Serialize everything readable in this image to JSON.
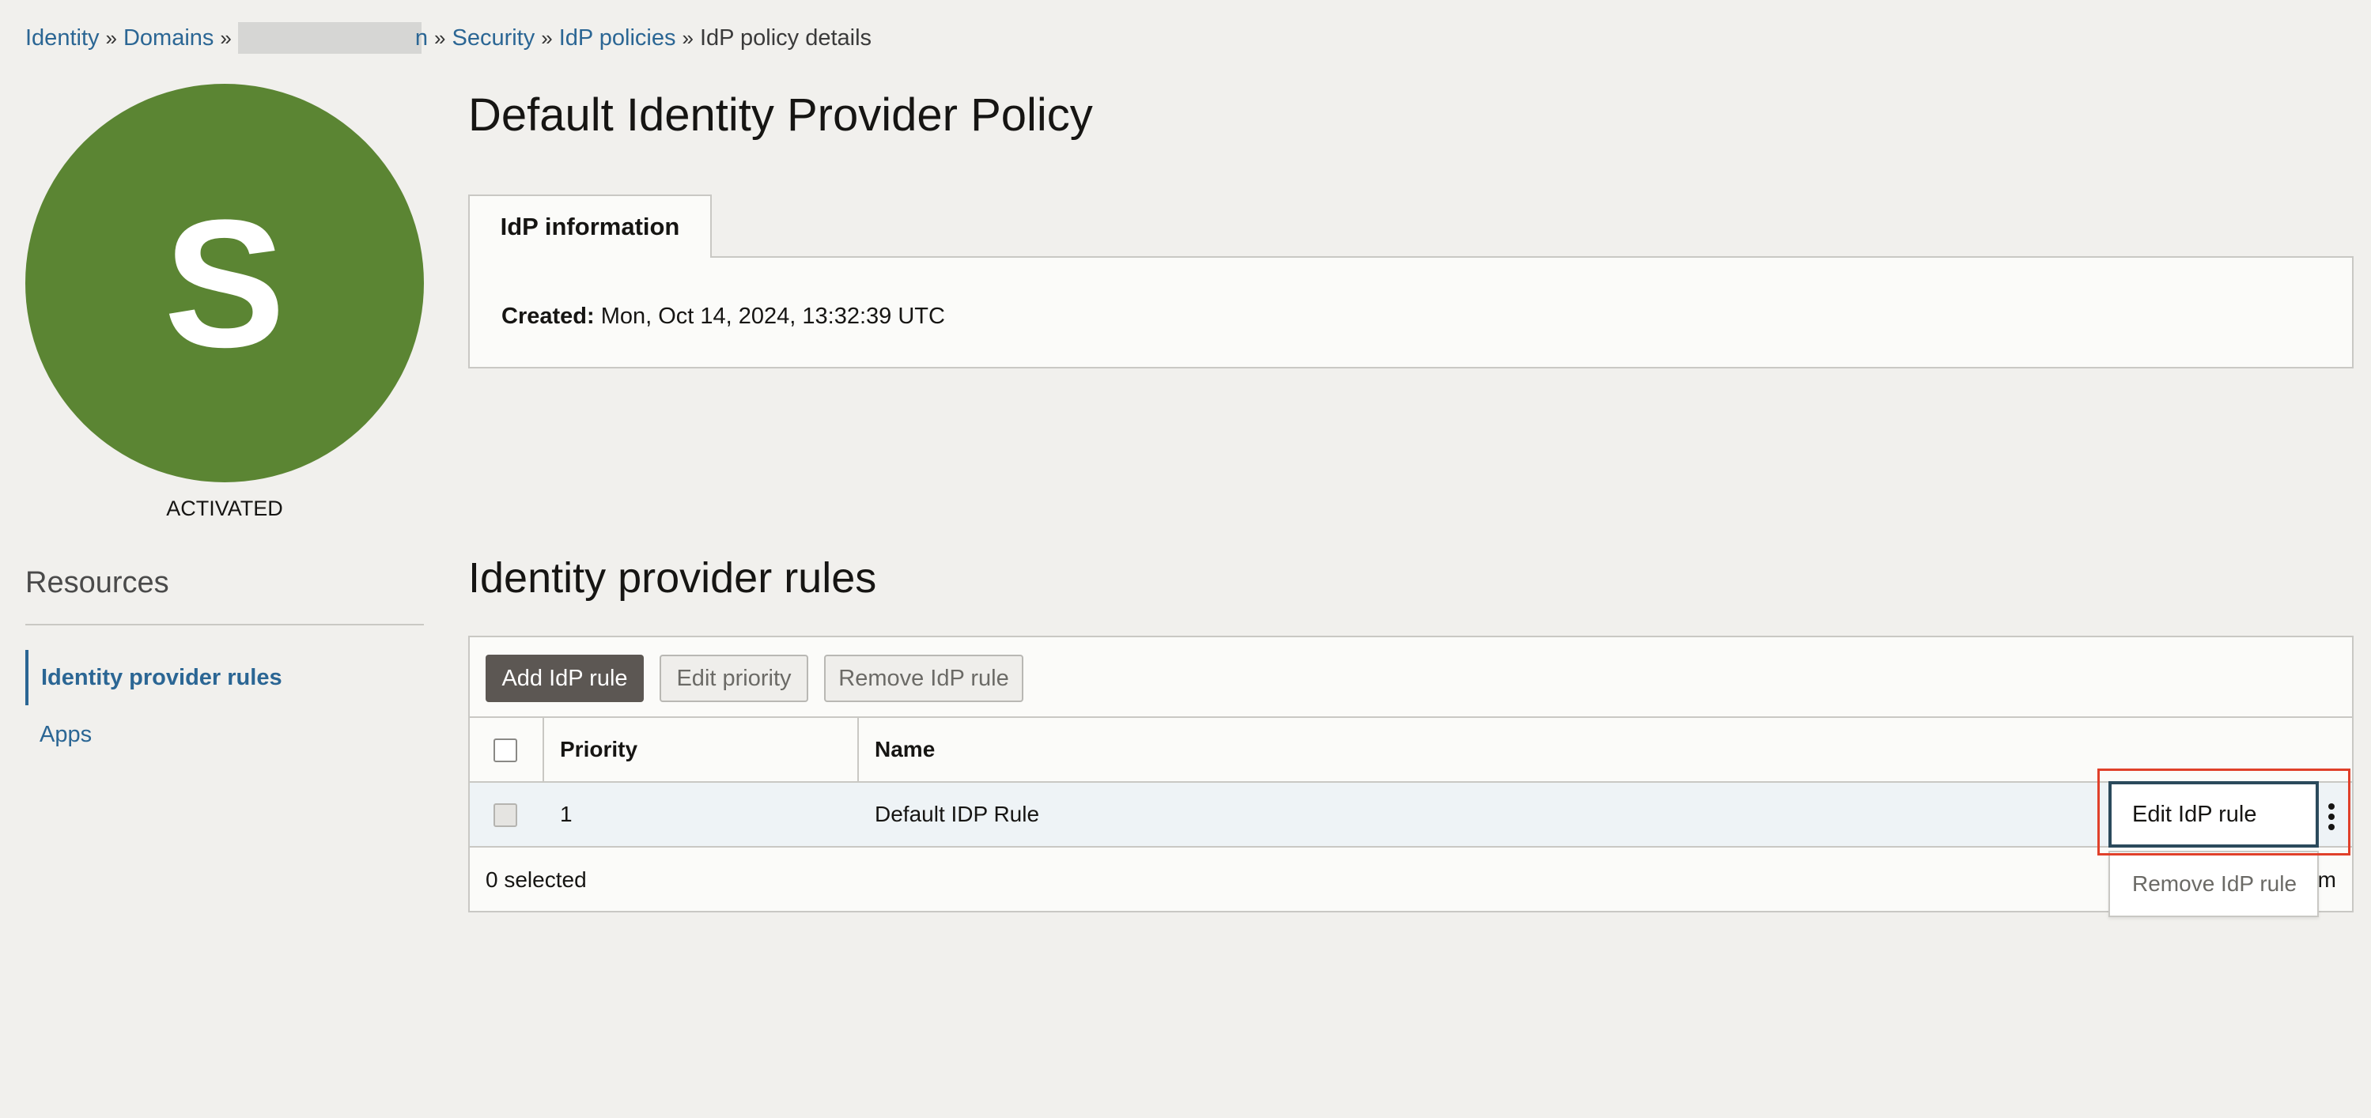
{
  "breadcrumb": {
    "items": [
      "Identity",
      "Domains",
      "Security",
      "IdP policies"
    ],
    "redacted_tail": "n",
    "current": "IdP policy details",
    "separator": "»"
  },
  "avatar": {
    "letter": "S",
    "color": "#5b8533"
  },
  "status": "ACTIVATED",
  "resources": {
    "title": "Resources",
    "items": [
      {
        "label": "Identity provider rules",
        "active": true
      },
      {
        "label": "Apps",
        "active": false
      }
    ]
  },
  "page": {
    "title": "Default Identity Provider Policy"
  },
  "tabs": [
    {
      "label": "IdP information"
    }
  ],
  "info": {
    "created_label": "Created:",
    "created_value": "Mon, Oct 14, 2024, 13:32:39 UTC"
  },
  "rules": {
    "title": "Identity provider rules",
    "toolbar": {
      "add": "Add IdP rule",
      "edit_priority": "Edit priority",
      "remove": "Remove IdP rule"
    },
    "columns": [
      "Priority",
      "Name"
    ],
    "rows": [
      {
        "priority": "1",
        "name": "Default IDP Rule"
      }
    ],
    "footer": {
      "selected": "0 selected",
      "tail": "m"
    }
  },
  "action_menu": {
    "items": [
      "Edit IdP rule",
      "Remove IdP rule"
    ],
    "icon": "kebab-icon"
  },
  "colors": {
    "link": "#2b6694",
    "primary_button": "#5c5753",
    "highlight": "#e0402a"
  }
}
